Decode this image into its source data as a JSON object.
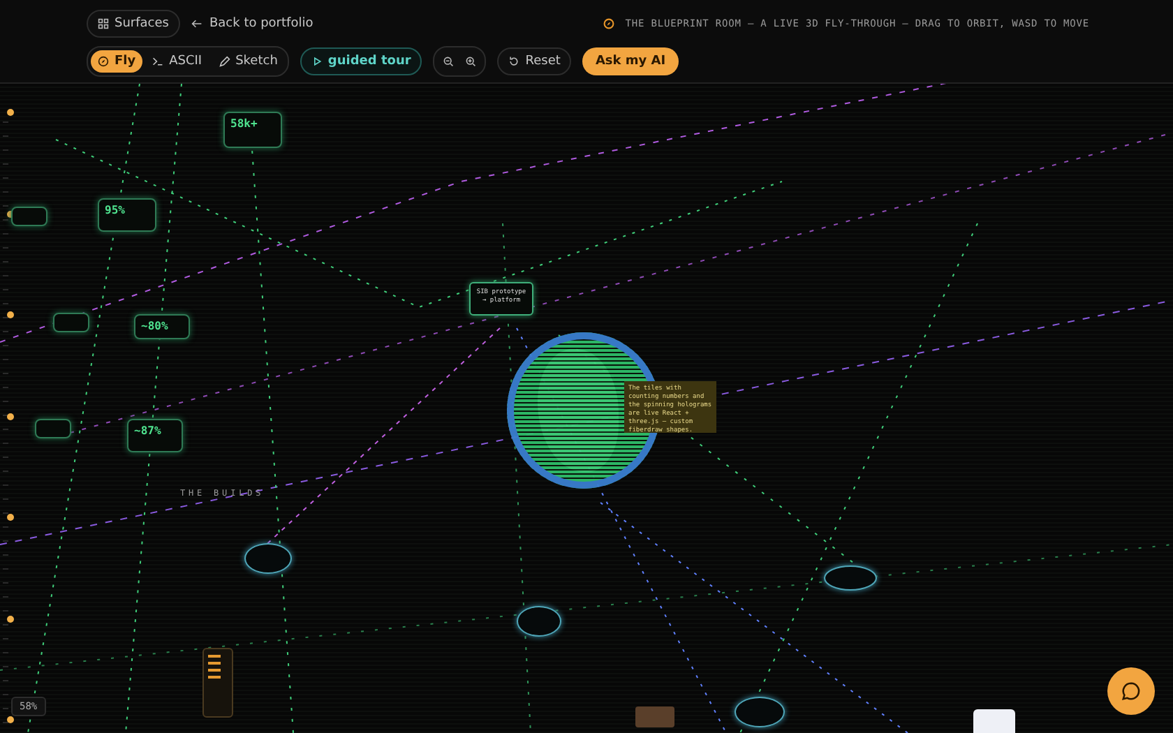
{
  "header": {
    "surfaces_button": "Surfaces",
    "back_link": "Back to portfolio",
    "tagline": "THE BLUEPRINT ROOM — A LIVE 3D FLY-THROUGH — DRAG TO ORBIT, WASD TO MOVE"
  },
  "toolbar": {
    "modes": [
      {
        "label": "Fly",
        "selected": true
      },
      {
        "label": "ASCII",
        "selected": false
      },
      {
        "label": "Sketch",
        "selected": false
      }
    ],
    "tour_button": "guided tour",
    "reset_button": "Reset",
    "ai_button": "Ask my AI"
  },
  "scene": {
    "stats": [
      {
        "value": "58k+"
      },
      {
        "value": "95%"
      },
      {
        "value": "~80%"
      },
      {
        "value": "~87%"
      }
    ],
    "prototype_node": "SIB prototype → platform",
    "tooltip": "The tiles with counting numbers and the spinning holograms are live React + three.js — custom fiberdraw shapes.",
    "section_label": "THE BUILDS",
    "zoom_readout": "58%"
  }
}
